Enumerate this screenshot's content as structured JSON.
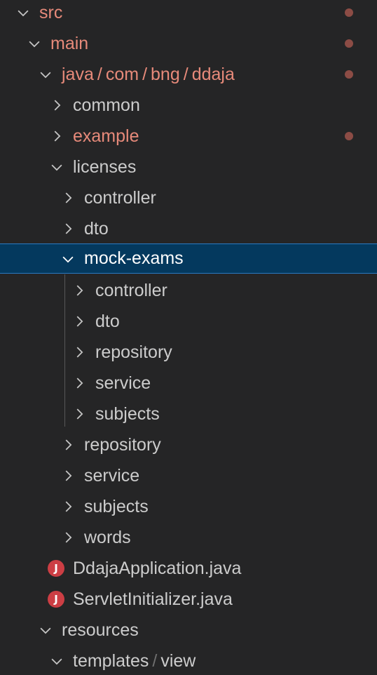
{
  "explorer": {
    "rows": [
      {
        "label": "src",
        "state": "expanded",
        "modified": true
      },
      {
        "label": "main",
        "state": "expanded",
        "modified": true
      },
      {
        "segments": [
          "java",
          "com",
          "bng",
          "ddaja"
        ],
        "separator": "/",
        "state": "expanded",
        "modified": true
      },
      {
        "label": "common",
        "state": "collapsed",
        "modified": false
      },
      {
        "label": "example",
        "state": "collapsed",
        "modified": true
      },
      {
        "label": "licenses",
        "state": "expanded",
        "modified": false
      },
      {
        "label": "controller",
        "state": "collapsed",
        "modified": false
      },
      {
        "label": "dto",
        "state": "collapsed",
        "modified": false
      },
      {
        "label": "mock-exams",
        "state": "expanded",
        "modified": false,
        "selected": true
      },
      {
        "label": "controller",
        "state": "collapsed",
        "modified": false
      },
      {
        "label": "dto",
        "state": "collapsed",
        "modified": false
      },
      {
        "label": "repository",
        "state": "collapsed",
        "modified": false
      },
      {
        "label": "service",
        "state": "collapsed",
        "modified": false
      },
      {
        "label": "subjects",
        "state": "collapsed",
        "modified": false
      },
      {
        "label": "repository",
        "state": "collapsed",
        "modified": false
      },
      {
        "label": "service",
        "state": "collapsed",
        "modified": false
      },
      {
        "label": "subjects",
        "state": "collapsed",
        "modified": false
      },
      {
        "label": "words",
        "state": "collapsed",
        "modified": false
      },
      {
        "label": "DdajaApplication.java",
        "type": "java-file",
        "icon_letter": "J"
      },
      {
        "label": "ServletInitializer.java",
        "type": "java-file",
        "icon_letter": "J"
      },
      {
        "label": "resources",
        "state": "expanded",
        "modified": false
      },
      {
        "segments": [
          "templates",
          "view"
        ],
        "separator": "/",
        "state": "expanded",
        "modified": false
      }
    ]
  },
  "colors": {
    "background": "#252526",
    "text": "#cccccc",
    "modified_text": "#e78a7a",
    "modified_dot": "#8c4c45",
    "selection_bg": "#04395e",
    "selection_border": "#2b79c2",
    "java_icon": "#cc3e44"
  },
  "icons": {
    "expanded": "chevron-down-icon",
    "collapsed": "chevron-right-icon",
    "java_file": "java-file-icon",
    "modified_marker": "modified-dot-icon"
  }
}
